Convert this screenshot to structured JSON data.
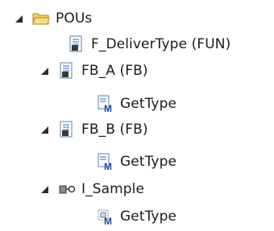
{
  "tree": {
    "root": {
      "label": "POUs",
      "expanded": true,
      "icon": "folder-open-icon"
    },
    "items": [
      {
        "label": "F_DeliverType (FUN)",
        "icon": "function-pou-icon"
      },
      {
        "label": "FB_A (FB)",
        "icon": "function-block-pou-icon",
        "expanded": true
      },
      {
        "label": "GetType",
        "icon": "method-icon"
      },
      {
        "label": "FB_B (FB)",
        "icon": "function-block-pou-icon",
        "expanded": true
      },
      {
        "label": "GetType",
        "icon": "method-icon"
      },
      {
        "label": "I_Sample",
        "icon": "interface-icon",
        "expanded": true
      },
      {
        "label": "GetType",
        "icon": "interface-method-icon"
      }
    ]
  },
  "colors": {
    "folder": "#e8c35a",
    "folder_dark": "#b88a1c",
    "doc_blue": "#2f6fb5",
    "method_blue": "#1e4fa6",
    "caret": "#2b2b2b"
  }
}
